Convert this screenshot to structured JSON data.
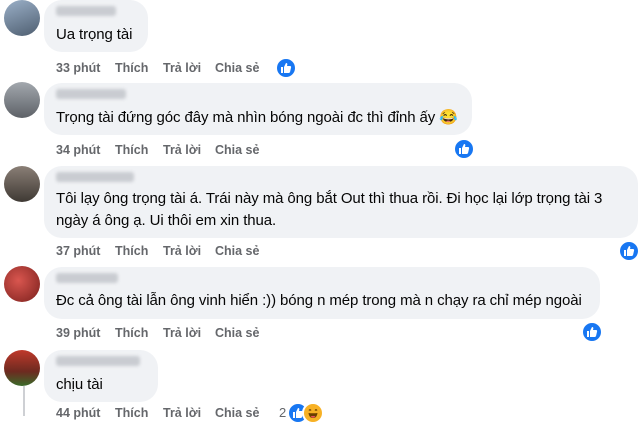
{
  "comments": [
    {
      "text_lines": [
        "Ua trọng tài"
      ],
      "time": "33 phút",
      "like_label": "Thích",
      "reply_label": "Trả lời",
      "share_label": "Chia sẻ",
      "reactions": [
        "like"
      ],
      "avatar_color": "#7d8fa3"
    },
    {
      "text_lines": [
        "Trọng tài đứng góc đây mà nhìn bóng ngoài đc thì đỉnh ấy 😂"
      ],
      "time": "34 phút",
      "like_label": "Thích",
      "reply_label": "Trả lời",
      "share_label": "Chia sẻ",
      "reactions": [
        "like"
      ],
      "avatar_color": "#8a8f96"
    },
    {
      "text_lines": [
        "Tôi lạy ông trọng tài á. Trái này mà ông bắt Out thì thua rồi. Đi học lại lớp trọng tài 3",
        "ngày á ông ạ. Ui thôi em xin thua."
      ],
      "time": "37 phút",
      "like_label": "Thích",
      "reply_label": "Trả lời",
      "share_label": "Chia sẻ",
      "reactions": [
        "like"
      ],
      "avatar_color": "#6b6560"
    },
    {
      "text_lines": [
        "Đc cả ông tài lẫn ông vinh hiển :)) bóng n mép trong mà n chạy ra chỉ mép ngoài"
      ],
      "time": "39 phút",
      "like_label": "Thích",
      "reply_label": "Trả lời",
      "share_label": "Chia sẻ",
      "reactions": [
        "like"
      ],
      "avatar_color": "#b0413e"
    },
    {
      "text_lines": [
        "chịu tài"
      ],
      "time": "44 phút",
      "like_label": "Thích",
      "reply_label": "Trả lời",
      "share_label": "Chia sẻ",
      "reactions": [
        "like",
        "haha"
      ],
      "reaction_count": "2",
      "avatar_color": "#8e3b2e"
    }
  ],
  "colors": {
    "bubble": "#f0f2f5",
    "meta_text": "#65676b",
    "like_blue": "#1877f2",
    "haha_yellow": "#f7b125"
  }
}
